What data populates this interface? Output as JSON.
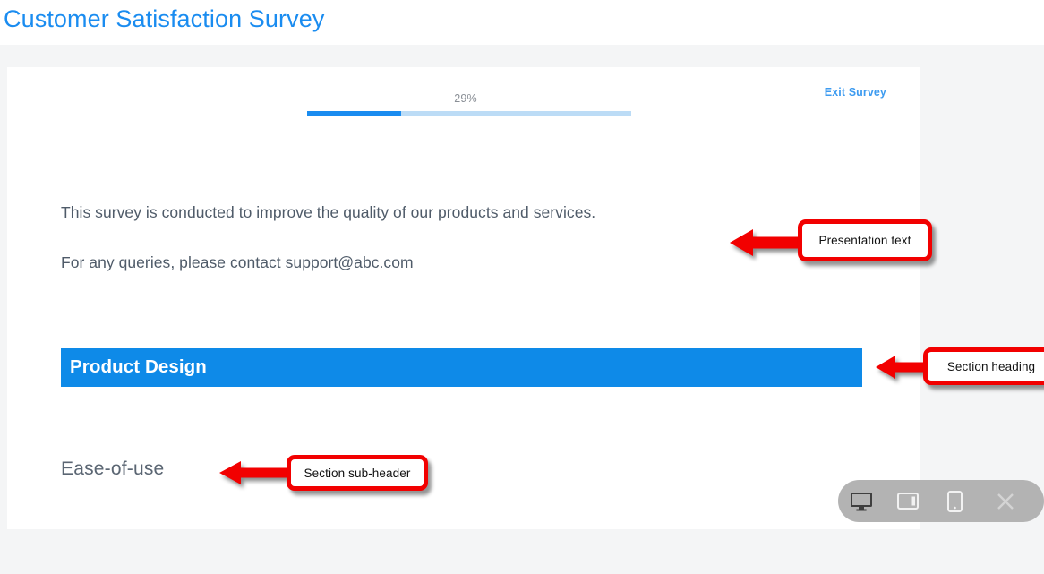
{
  "header": {
    "title": "Customer Satisfaction Survey",
    "title_color": "#1a8cf0"
  },
  "survey": {
    "progress": {
      "percent_label": "29%",
      "percent_value": 29,
      "fill_color": "#1a8cf0",
      "track_color": "#bcdcf6"
    },
    "exit_link": {
      "label": "Exit Survey",
      "color": "#3d9bf0"
    },
    "intro": {
      "line_1": "This survey is conducted to improve the quality of our products and services.",
      "line_2": "For any queries, please contact support@abc.com"
    },
    "section": {
      "heading": "Product Design",
      "heading_bg": "#0e8ae8",
      "heading_color": "#ffffff",
      "sub_header": "Ease-of-use"
    }
  },
  "annotations": {
    "accent_color": "#f20000",
    "presentation": {
      "label": "Presentation text"
    },
    "section_heading": {
      "label": "Section heading"
    },
    "sub_header": {
      "label": "Section sub-header"
    }
  },
  "device_toolbar": {
    "bg_color": "#b3b3b3",
    "buttons": [
      {
        "name": "desktop",
        "active": true
      },
      {
        "name": "tablet",
        "active": false
      },
      {
        "name": "mobile",
        "active": false
      },
      {
        "name": "close",
        "active": false
      }
    ]
  }
}
